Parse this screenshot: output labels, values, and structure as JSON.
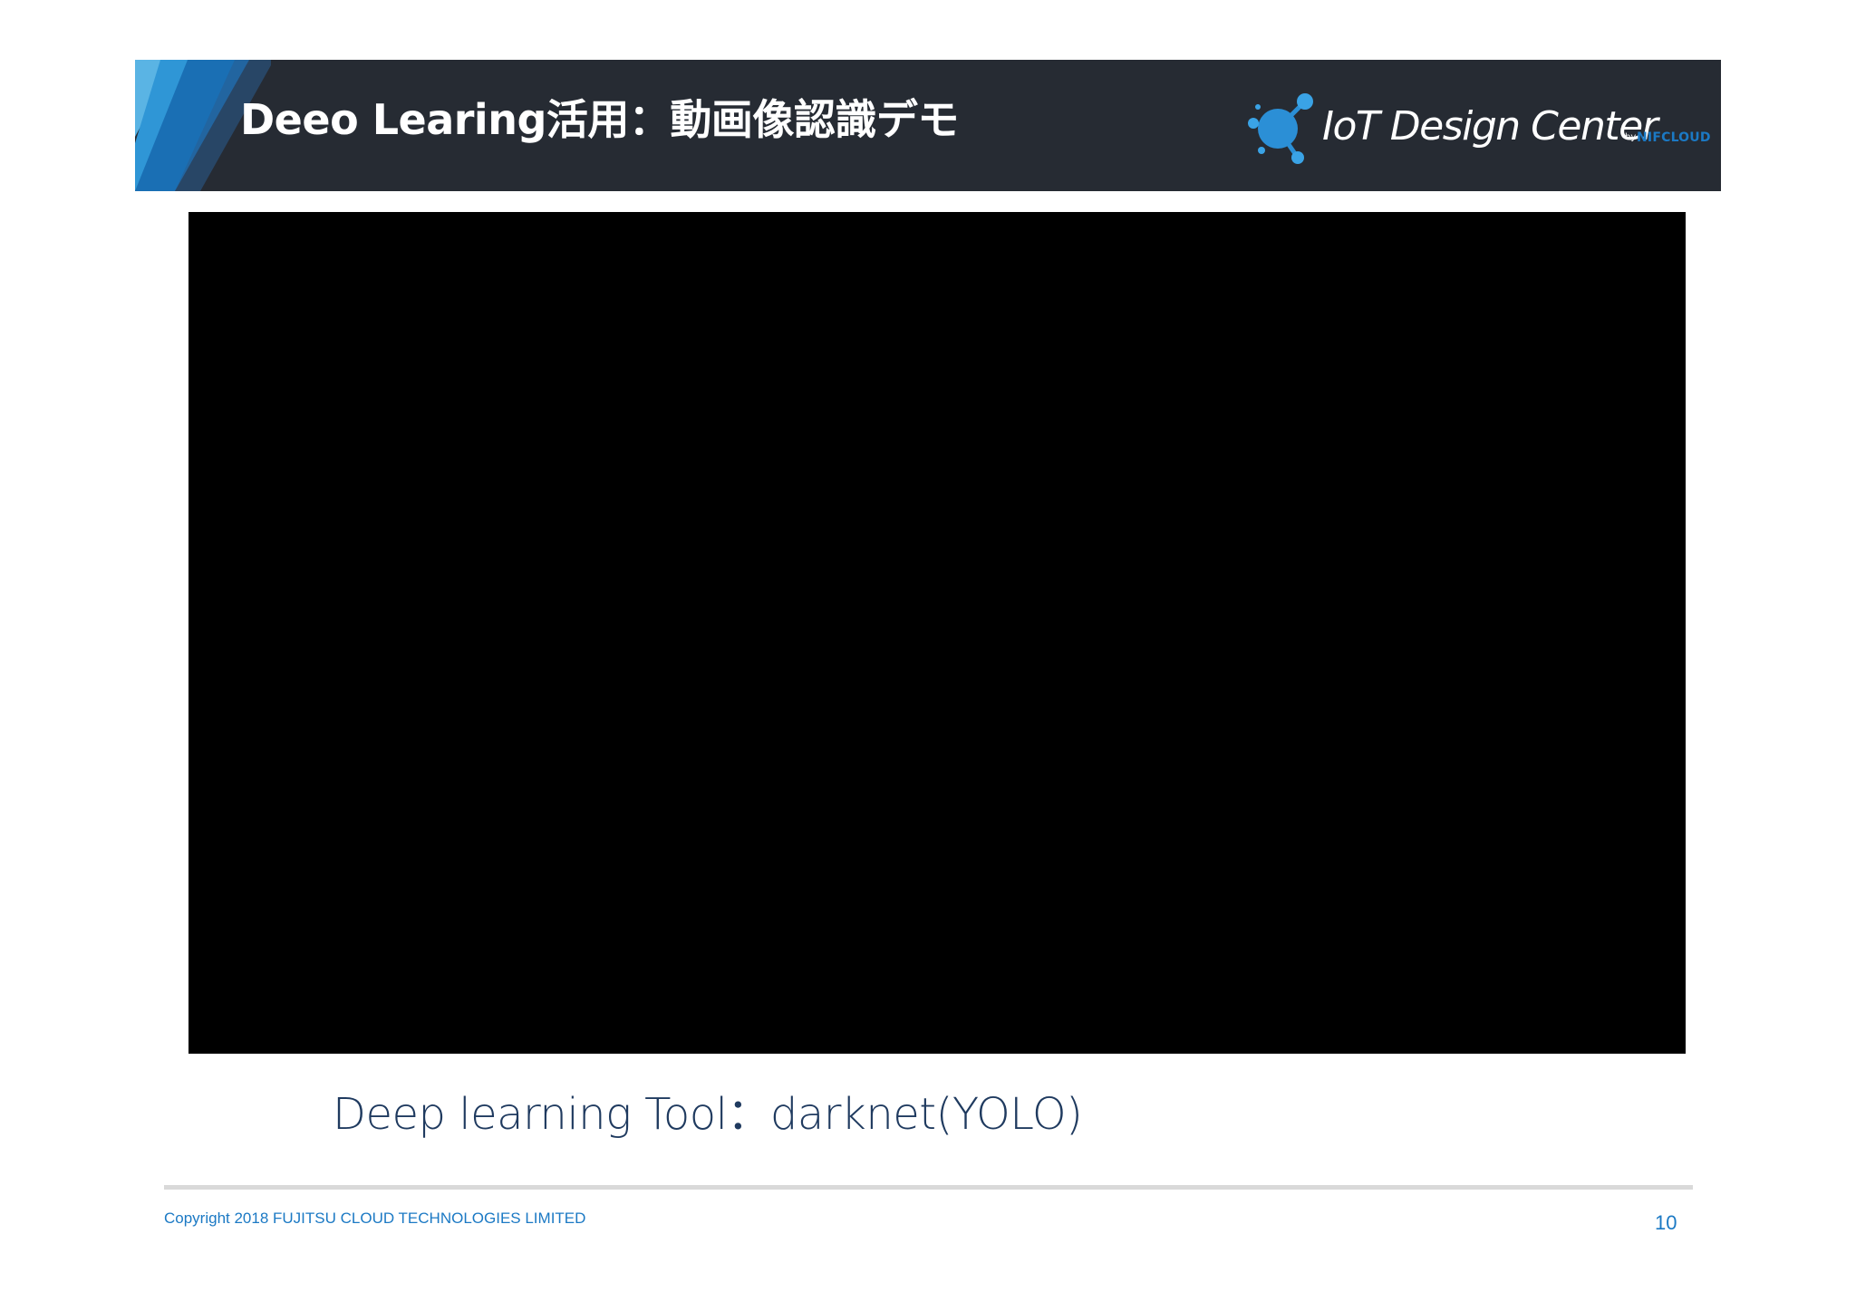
{
  "header": {
    "title": "Deeo Learing活用：動画像認識デモ",
    "logo": {
      "icon": "iot-molecule-icon",
      "text": "IoT Design Center",
      "by": "by",
      "brand": "NIFCLOUD"
    }
  },
  "main": {
    "video_icon": "video-frame",
    "caption": "Deep learning Tool：darknet(YOLO)"
  },
  "footer": {
    "copyright": "Copyright 2018 FUJITSU CLOUD TECHNOLOGIES LIMITED",
    "page_number": "10"
  },
  "colors": {
    "header_bg": "#262b33",
    "accent_blue": "#1b79c4",
    "caption_text": "#1f3a5f",
    "divider": "#d9d9d9"
  }
}
